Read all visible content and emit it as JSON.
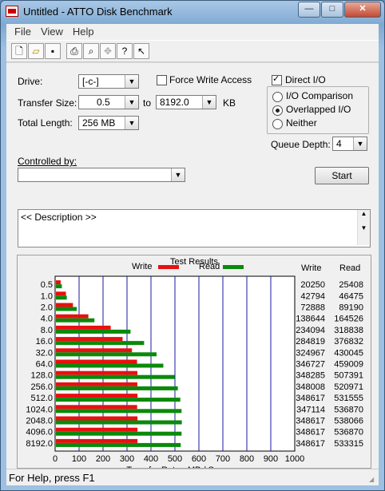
{
  "window": {
    "title": "Untitled - ATTO Disk Benchmark"
  },
  "titlebar_buttons": {
    "minimize": "—",
    "maximize": "□",
    "close": "✕"
  },
  "menu": [
    "File",
    "View",
    "Help"
  ],
  "toolbar": {
    "icons": [
      "new-icon",
      "open-icon",
      "save-icon",
      "print-icon",
      "print-preview-icon",
      "move-icon",
      "help-icon",
      "context-help-icon"
    ]
  },
  "drive": {
    "label": "Drive:",
    "value": "[-c-]"
  },
  "force_write": {
    "label": "Force Write Access",
    "checked": false
  },
  "direct_io": {
    "label": "Direct I/O",
    "checked": true
  },
  "transfer": {
    "label": "Transfer Size:",
    "from": "0.5",
    "to_label": "to",
    "to": "8192.0",
    "unit": "KB"
  },
  "total_length": {
    "label": "Total Length:",
    "value": "256 MB"
  },
  "io_mode": {
    "options": [
      "I/O Comparison",
      "Overlapped I/O",
      "Neither"
    ],
    "selected": "Overlapped I/O"
  },
  "queue_depth": {
    "label": "Queue Depth:",
    "value": "4"
  },
  "controlled_by": {
    "label": "Controlled by:",
    "value": ""
  },
  "start_button": "Start",
  "description": "<< Description >>",
  "status": "For Help, press F1",
  "colors": {
    "write": "#e81010",
    "read": "#0a8a0a",
    "grid": "#1a1aa0"
  },
  "chart_data": {
    "type": "bar",
    "title": "Test Results",
    "xlabel": "Transfer Rate - MB / Sec",
    "legend": [
      "Write",
      "Read"
    ],
    "col_headers": [
      "Write",
      "Read"
    ],
    "xlim": [
      0,
      1000
    ],
    "x_ticks": [
      "0",
      "100",
      "200",
      "300",
      "400",
      "500",
      "600",
      "700",
      "800",
      "900",
      "1000"
    ],
    "categories": [
      "0.5",
      "1.0",
      "2.0",
      "4.0",
      "8.0",
      "16.0",
      "32.0",
      "64.0",
      "128.0",
      "256.0",
      "512.0",
      "1024.0",
      "2048.0",
      "4096.0",
      "8192.0"
    ],
    "series": [
      {
        "name": "Write",
        "values": [
          20250,
          42794,
          72888,
          138644,
          234094,
          284819,
          324967,
          346727,
          348285,
          348008,
          348617,
          347114,
          348617,
          348617,
          348617
        ]
      },
      {
        "name": "Read",
        "values": [
          25408,
          46475,
          89190,
          164526,
          318838,
          376832,
          430045,
          459009,
          507391,
          520971,
          531555,
          536870,
          538066,
          536870,
          533315
        ]
      }
    ]
  }
}
